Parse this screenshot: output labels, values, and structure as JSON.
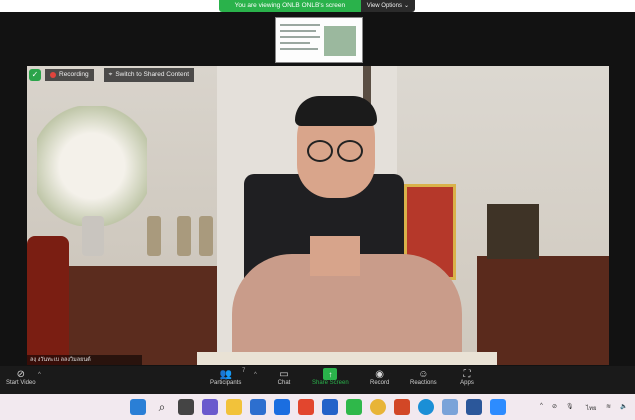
{
  "banner": {
    "text": "You are viewing ONLB ONLB's screen",
    "view_options": "View Options"
  },
  "video": {
    "recording_label": "Recording",
    "switch_label": "Switch to Shared Content",
    "name_tag": "ลงฺ งวันทะเบ ลลงวิมลยนต์"
  },
  "toolbar": {
    "start_video": "Start Video",
    "participants": "Participants",
    "participants_count": "7",
    "chat": "Chat",
    "share_screen": "Share Screen",
    "record": "Record",
    "reactions": "Reactions",
    "apps": "Apps"
  },
  "tray": {
    "lang": "ไทย"
  },
  "colors": {
    "banner": "#2ab24b",
    "toolbar": "#1a1a1a",
    "taskbar": "#f2e9ef"
  }
}
